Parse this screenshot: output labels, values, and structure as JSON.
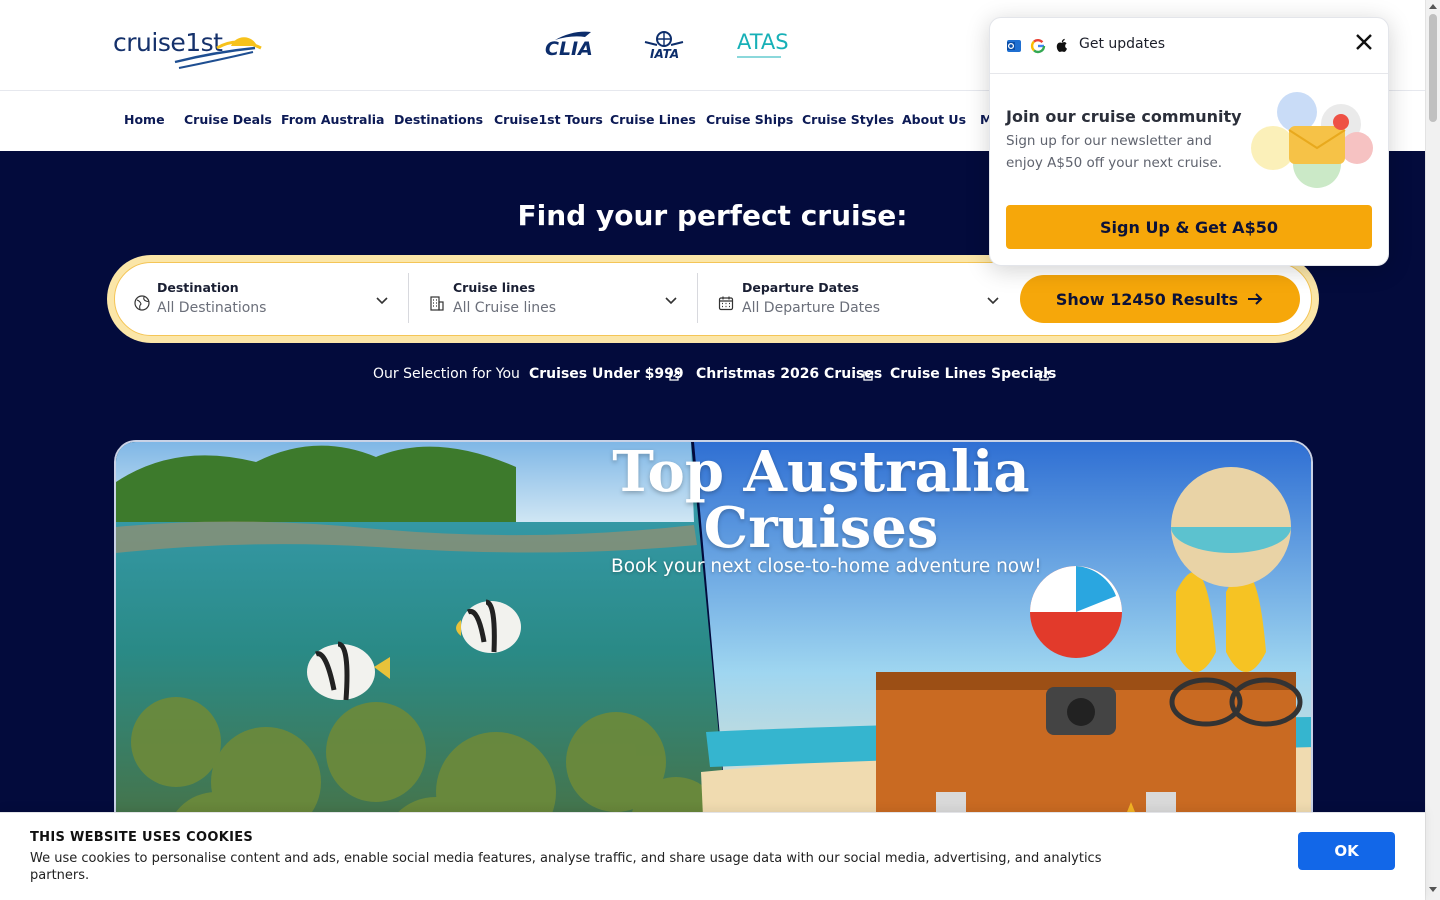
{
  "header": {
    "logo_text": "cruise1st",
    "certifications": [
      "CLIA",
      "IATA",
      "ATAS"
    ]
  },
  "nav": {
    "items": [
      "Home",
      "Cruise Deals",
      "From Australia",
      "Destinations",
      "Cruise1st Tours",
      "Cruise Lines",
      "Cruise Ships",
      "Cruise Styles",
      "About Us",
      "M"
    ]
  },
  "hero": {
    "title": "Find your perfect cruise:",
    "search": {
      "destination": {
        "label": "Destination",
        "value": "All Destinations",
        "icon": "globe-icon"
      },
      "cruise_lines": {
        "label": "Cruise lines",
        "value": "All Cruise lines",
        "icon": "building-icon"
      },
      "departure": {
        "label": "Departure Dates",
        "value": "All Departure Dates",
        "icon": "calendar-icon"
      },
      "button_label": "Show 12450 Results"
    },
    "selection": {
      "label": "Our Selection for You",
      "links": [
        "Cruises Under $999",
        "Christmas 2026 Cruises",
        "Cruise Lines Specials"
      ]
    },
    "banner": {
      "title": "Top Australia Cruises",
      "subtitle": "Book your next close-to-home adventure now!"
    }
  },
  "popup": {
    "header_title": "Get updates",
    "heading": "Join our cruise community",
    "text": "Sign up for our newsletter and enjoy A$50 off your next cruise.",
    "button_label": "Sign Up & Get A$50",
    "icons": [
      "outlook-icon",
      "google-icon",
      "apple-icon"
    ]
  },
  "cookie": {
    "title": "THIS WEBSITE USES COOKIES",
    "text": "We use cookies to personalise content and ads, enable social media features, analyse traffic, and share usage data with our social media, advertising, and analytics partners.",
    "ok_label": "OK"
  },
  "colors": {
    "navy": "#030b3c",
    "accent": "#f6a70a",
    "nav_text": "#0c1a55",
    "cookie_button": "#1267e8"
  }
}
